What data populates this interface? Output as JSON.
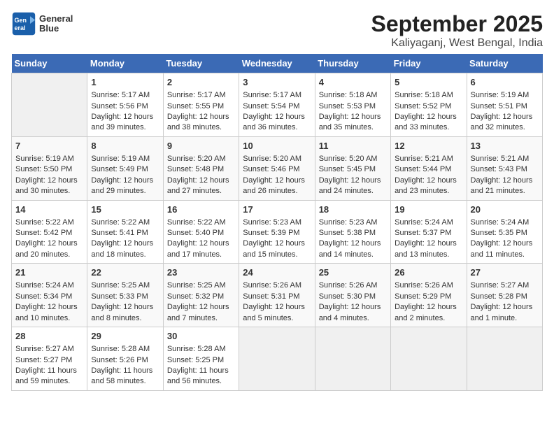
{
  "logo": {
    "line1": "General",
    "line2": "Blue"
  },
  "title": "September 2025",
  "subtitle": "Kaliyaganj, West Bengal, India",
  "days_of_week": [
    "Sunday",
    "Monday",
    "Tuesday",
    "Wednesday",
    "Thursday",
    "Friday",
    "Saturday"
  ],
  "weeks": [
    [
      {
        "day": "",
        "content": ""
      },
      {
        "day": "1",
        "content": "Sunrise: 5:17 AM\nSunset: 5:56 PM\nDaylight: 12 hours\nand 39 minutes."
      },
      {
        "day": "2",
        "content": "Sunrise: 5:17 AM\nSunset: 5:55 PM\nDaylight: 12 hours\nand 38 minutes."
      },
      {
        "day": "3",
        "content": "Sunrise: 5:17 AM\nSunset: 5:54 PM\nDaylight: 12 hours\nand 36 minutes."
      },
      {
        "day": "4",
        "content": "Sunrise: 5:18 AM\nSunset: 5:53 PM\nDaylight: 12 hours\nand 35 minutes."
      },
      {
        "day": "5",
        "content": "Sunrise: 5:18 AM\nSunset: 5:52 PM\nDaylight: 12 hours\nand 33 minutes."
      },
      {
        "day": "6",
        "content": "Sunrise: 5:19 AM\nSunset: 5:51 PM\nDaylight: 12 hours\nand 32 minutes."
      }
    ],
    [
      {
        "day": "7",
        "content": "Sunrise: 5:19 AM\nSunset: 5:50 PM\nDaylight: 12 hours\nand 30 minutes."
      },
      {
        "day": "8",
        "content": "Sunrise: 5:19 AM\nSunset: 5:49 PM\nDaylight: 12 hours\nand 29 minutes."
      },
      {
        "day": "9",
        "content": "Sunrise: 5:20 AM\nSunset: 5:48 PM\nDaylight: 12 hours\nand 27 minutes."
      },
      {
        "day": "10",
        "content": "Sunrise: 5:20 AM\nSunset: 5:46 PM\nDaylight: 12 hours\nand 26 minutes."
      },
      {
        "day": "11",
        "content": "Sunrise: 5:20 AM\nSunset: 5:45 PM\nDaylight: 12 hours\nand 24 minutes."
      },
      {
        "day": "12",
        "content": "Sunrise: 5:21 AM\nSunset: 5:44 PM\nDaylight: 12 hours\nand 23 minutes."
      },
      {
        "day": "13",
        "content": "Sunrise: 5:21 AM\nSunset: 5:43 PM\nDaylight: 12 hours\nand 21 minutes."
      }
    ],
    [
      {
        "day": "14",
        "content": "Sunrise: 5:22 AM\nSunset: 5:42 PM\nDaylight: 12 hours\nand 20 minutes."
      },
      {
        "day": "15",
        "content": "Sunrise: 5:22 AM\nSunset: 5:41 PM\nDaylight: 12 hours\nand 18 minutes."
      },
      {
        "day": "16",
        "content": "Sunrise: 5:22 AM\nSunset: 5:40 PM\nDaylight: 12 hours\nand 17 minutes."
      },
      {
        "day": "17",
        "content": "Sunrise: 5:23 AM\nSunset: 5:39 PM\nDaylight: 12 hours\nand 15 minutes."
      },
      {
        "day": "18",
        "content": "Sunrise: 5:23 AM\nSunset: 5:38 PM\nDaylight: 12 hours\nand 14 minutes."
      },
      {
        "day": "19",
        "content": "Sunrise: 5:24 AM\nSunset: 5:37 PM\nDaylight: 12 hours\nand 13 minutes."
      },
      {
        "day": "20",
        "content": "Sunrise: 5:24 AM\nSunset: 5:35 PM\nDaylight: 12 hours\nand 11 minutes."
      }
    ],
    [
      {
        "day": "21",
        "content": "Sunrise: 5:24 AM\nSunset: 5:34 PM\nDaylight: 12 hours\nand 10 minutes."
      },
      {
        "day": "22",
        "content": "Sunrise: 5:25 AM\nSunset: 5:33 PM\nDaylight: 12 hours\nand 8 minutes."
      },
      {
        "day": "23",
        "content": "Sunrise: 5:25 AM\nSunset: 5:32 PM\nDaylight: 12 hours\nand 7 minutes."
      },
      {
        "day": "24",
        "content": "Sunrise: 5:26 AM\nSunset: 5:31 PM\nDaylight: 12 hours\nand 5 minutes."
      },
      {
        "day": "25",
        "content": "Sunrise: 5:26 AM\nSunset: 5:30 PM\nDaylight: 12 hours\nand 4 minutes."
      },
      {
        "day": "26",
        "content": "Sunrise: 5:26 AM\nSunset: 5:29 PM\nDaylight: 12 hours\nand 2 minutes."
      },
      {
        "day": "27",
        "content": "Sunrise: 5:27 AM\nSunset: 5:28 PM\nDaylight: 12 hours\nand 1 minute."
      }
    ],
    [
      {
        "day": "28",
        "content": "Sunrise: 5:27 AM\nSunset: 5:27 PM\nDaylight: 11 hours\nand 59 minutes."
      },
      {
        "day": "29",
        "content": "Sunrise: 5:28 AM\nSunset: 5:26 PM\nDaylight: 11 hours\nand 58 minutes."
      },
      {
        "day": "30",
        "content": "Sunrise: 5:28 AM\nSunset: 5:25 PM\nDaylight: 11 hours\nand 56 minutes."
      },
      {
        "day": "",
        "content": ""
      },
      {
        "day": "",
        "content": ""
      },
      {
        "day": "",
        "content": ""
      },
      {
        "day": "",
        "content": ""
      }
    ]
  ]
}
